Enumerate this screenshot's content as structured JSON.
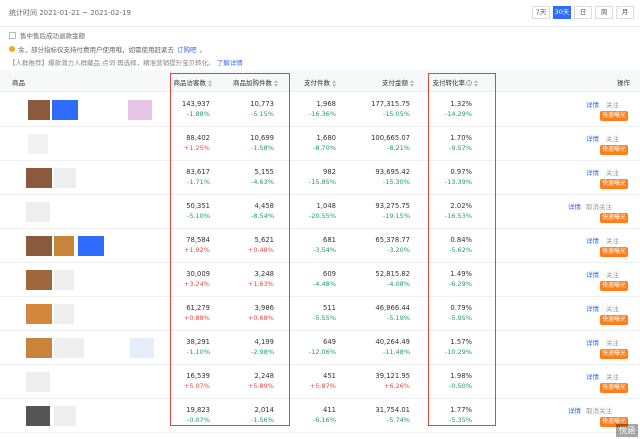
{
  "header": {
    "date_range": "统计时间 2021-01-21 ~ 2021-02-19",
    "range_tabs": [
      {
        "label": "7天",
        "active": false
      },
      {
        "label": "30天",
        "active": true
      },
      {
        "label": "日",
        "active": false
      },
      {
        "label": "周",
        "active": false
      },
      {
        "label": "月",
        "active": false
      }
    ]
  },
  "filter": {
    "label": "售中售后成功退款金额"
  },
  "notices": {
    "line1_text": "余，部分指标仅支持付费用户使用哦，如需使用赶紧去",
    "line1_link": "订购吧",
    "line1_end": "。",
    "line2_text": "【人群推荐】爆款潜力人群藏品·点词·再选择，精准营销提升宝贝转化。",
    "line2_link": "了解详情"
  },
  "table": {
    "columns": {
      "product": "商品",
      "visitors": "商品访客数",
      "buyers": "商品加购件数",
      "pay_count": "支付件数",
      "pay_amount": "支付金额",
      "conversion": "支付转化率",
      "ops": "操作"
    },
    "rows": [
      {
        "visitors": "143,937",
        "visitors_p": "-1.88%",
        "buyers": "10,773",
        "buyers_p": "-5.15%",
        "pay_count": "1,968",
        "pay_count_p": "-16.36%",
        "amount": "177,315.75",
        "amount_p": "-15.05%",
        "conv": "1.32%",
        "conv_p": "-14.29%",
        "op1": "详情",
        "op2": "关注",
        "boost": "快速曝光"
      },
      {
        "visitors": "88,402",
        "visitors_p": "+1.25%",
        "buyers": "10,699",
        "buyers_p": "-1.58%",
        "pay_count": "1,680",
        "pay_count_p": "-8.70%",
        "amount": "100,665.07",
        "amount_p": "-8.21%",
        "conv": "1.70%",
        "conv_p": "-9.57%",
        "op1": "详情",
        "op2": "关注",
        "boost": "快速曝光"
      },
      {
        "visitors": "83,617",
        "visitors_p": "-1.71%",
        "buyers": "5,155",
        "buyers_p": "-4.63%",
        "pay_count": "982",
        "pay_count_p": "-15.85%",
        "amount": "93,695.42",
        "amount_p": "-15.30%",
        "conv": "0.97%",
        "conv_p": "-13.39%",
        "op1": "详情",
        "op2": "关注",
        "boost": "快速曝光"
      },
      {
        "visitors": "50,351",
        "visitors_p": "-5.10%",
        "buyers": "4,458",
        "buyers_p": "-8.54%",
        "pay_count": "1,048",
        "pay_count_p": "-20.55%",
        "amount": "93,275.75",
        "amount_p": "-19.15%",
        "conv": "2.02%",
        "conv_p": "-16.53%",
        "op1": "详情",
        "op2": "取消关注",
        "boost": "快速曝光"
      },
      {
        "visitors": "78,584",
        "visitors_p": "+1.92%",
        "buyers": "5,621",
        "buyers_p": "+0.48%",
        "pay_count": "681",
        "pay_count_p": "-3.54%",
        "amount": "65,378.77",
        "amount_p": "-3.20%",
        "conv": "0.84%",
        "conv_p": "-5.62%",
        "op1": "详情",
        "op2": "关注",
        "boost": "快速曝光"
      },
      {
        "visitors": "30,009",
        "visitors_p": "+3.24%",
        "buyers": "3,248",
        "buyers_p": "+1.63%",
        "pay_count": "609",
        "pay_count_p": "-4.48%",
        "amount": "52,815.82",
        "amount_p": "-4.08%",
        "conv": "1.49%",
        "conv_p": "-6.29%",
        "op1": "详情",
        "op2": "关注",
        "boost": "快速曝光"
      },
      {
        "visitors": "61,279",
        "visitors_p": "+0.88%",
        "buyers": "3,986",
        "buyers_p": "+0.68%",
        "pay_count": "511",
        "pay_count_p": "-5.55%",
        "amount": "46,866.44",
        "amount_p": "-5.19%",
        "conv": "0.79%",
        "conv_p": "-5.95%",
        "op1": "详情",
        "op2": "关注",
        "boost": "快速曝光"
      },
      {
        "visitors": "38,291",
        "visitors_p": "-1.10%",
        "buyers": "4,199",
        "buyers_p": "-2.98%",
        "pay_count": "649",
        "pay_count_p": "-12.06%",
        "amount": "40,264.49",
        "amount_p": "-11.48%",
        "conv": "1.57%",
        "conv_p": "-10.29%",
        "op1": "详情",
        "op2": "关注",
        "boost": "快速曝光"
      },
      {
        "visitors": "16,539",
        "visitors_p": "+5.07%",
        "buyers": "2,248",
        "buyers_p": "+5.89%",
        "pay_count": "451",
        "pay_count_p": "+5.87%",
        "amount": "39,121.95",
        "amount_p": "+6.26%",
        "conv": "1.98%",
        "conv_p": "-0.50%",
        "op1": "详情",
        "op2": "关注",
        "boost": "快速曝光"
      },
      {
        "visitors": "19,823",
        "visitors_p": "-0.07%",
        "buyers": "2,014",
        "buyers_p": "-1.56%",
        "pay_count": "411",
        "pay_count_p": "-6.16%",
        "amount": "31,754.01",
        "amount_p": "-5.74%",
        "conv": "1.77%",
        "conv_p": "-5.35%",
        "op1": "详情",
        "op2": "取消关注",
        "boost": "快速曝光"
      }
    ]
  },
  "colors": {
    "accent": "#2f6bff",
    "boost": "#ff7d1a",
    "highlight_box": "#e2473b"
  },
  "watermark": "悦涵"
}
